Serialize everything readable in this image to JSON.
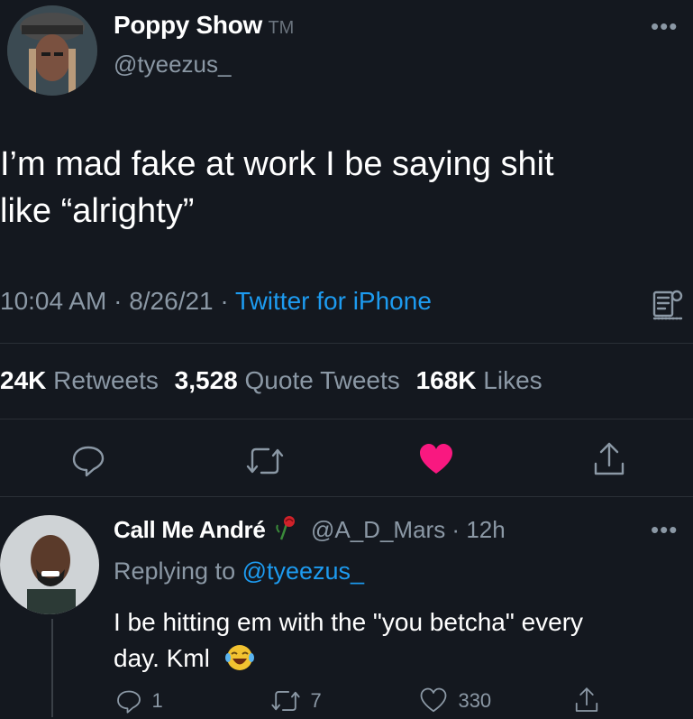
{
  "tweet": {
    "display_name": "Poppy Show",
    "tm_mark": "TM",
    "handle": "@tyeezus_",
    "text_line1": "I’m mad fake at work I be saying shit",
    "text_line2": "like “alrighty”",
    "time": "10:04 AM",
    "sep1": " · ",
    "date": "8/26/21",
    "sep2": " · ",
    "source": "Twitter for iPhone",
    "stats": {
      "retweets_count": "24K",
      "retweets_label": "Retweets",
      "quotes_count": "3,528",
      "quotes_label": "Quote Tweets",
      "likes_count": "168K",
      "likes_label": "Likes"
    },
    "liked": true
  },
  "reply": {
    "display_name": "Call Me André",
    "handle": "@A_D_Mars",
    "sep": " · ",
    "age": "12h",
    "replying_prefix": "Replying to ",
    "replying_handle": "@tyeezus_",
    "text_line1": "I be hitting em with the \"you betcha\" every",
    "text_line2": "day. Kml",
    "reply_count": "1",
    "retweet_count": "7",
    "like_count": "330"
  },
  "more_menu": "•••",
  "colors": {
    "background": "#14181f",
    "link": "#1d9bf0",
    "like": "#f91880",
    "muted": "#8b98a5"
  },
  "icons": [
    "reply-icon",
    "retweet-icon",
    "like-icon",
    "share-icon",
    "analytics-icon",
    "more-icon",
    "rose-emoji",
    "laughing-emoji"
  ]
}
